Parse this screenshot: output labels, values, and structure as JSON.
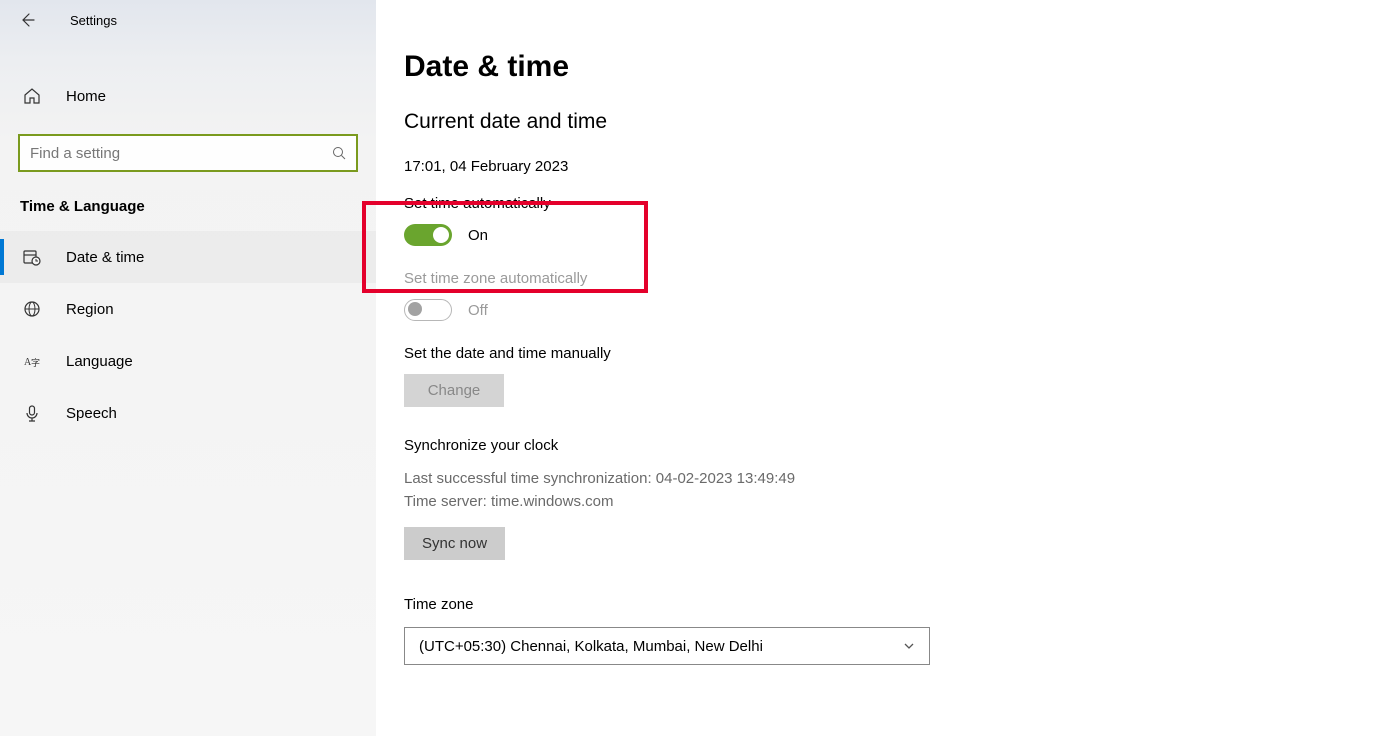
{
  "header": {
    "app_title": "Settings"
  },
  "sidebar": {
    "home_label": "Home",
    "search_placeholder": "Find a setting",
    "section_title": "Time & Language",
    "items": [
      {
        "label": "Date & time"
      },
      {
        "label": "Region"
      },
      {
        "label": "Language"
      },
      {
        "label": "Speech"
      }
    ]
  },
  "main": {
    "title": "Date & time",
    "current_heading": "Current date and time",
    "current_value": "17:01, 04 February 2023",
    "set_time_auto": {
      "label": "Set time automatically",
      "state_text": "On"
    },
    "set_tz_auto": {
      "label": "Set time zone automatically",
      "state_text": "Off"
    },
    "manual": {
      "label": "Set the date and time manually",
      "button": "Change"
    },
    "sync": {
      "heading": "Synchronize your clock",
      "last_sync": "Last successful time synchronization: 04-02-2023 13:49:49",
      "server": "Time server: time.windows.com",
      "button": "Sync now"
    },
    "timezone": {
      "label": "Time zone",
      "selected": "(UTC+05:30) Chennai, Kolkata, Mumbai, New Delhi"
    }
  }
}
